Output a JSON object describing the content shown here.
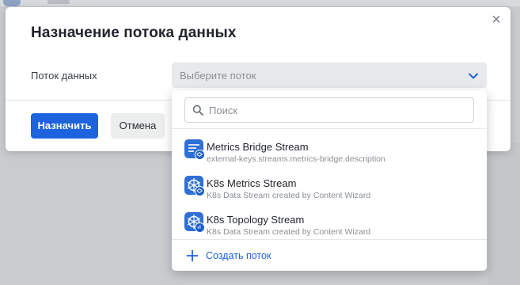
{
  "modal": {
    "title": "Назначение потока данных",
    "close_icon": "close-icon",
    "field_label": "Поток данных",
    "select_placeholder": "Выберите поток",
    "assign_button": "Назначить",
    "cancel_button": "Отмена"
  },
  "dropdown": {
    "search_placeholder": "Поиск",
    "items": [
      {
        "title": "Metrics Bridge Stream",
        "description": "external-keys.streams.metrics-bridge.description",
        "icon": "metrics-bridge-icon"
      },
      {
        "title": "K8s Metrics Stream",
        "description": "K8s Data Stream created by Content Wizard",
        "icon": "kubernetes-icon"
      },
      {
        "title": "K8s Topology Stream",
        "description": "K8s Data Stream created by Content Wizard",
        "icon": "kubernetes-icon"
      }
    ],
    "create_label": "Создать поток"
  },
  "colors": {
    "accent": "#1e63de",
    "icon_bg": "#2f6fd6"
  }
}
